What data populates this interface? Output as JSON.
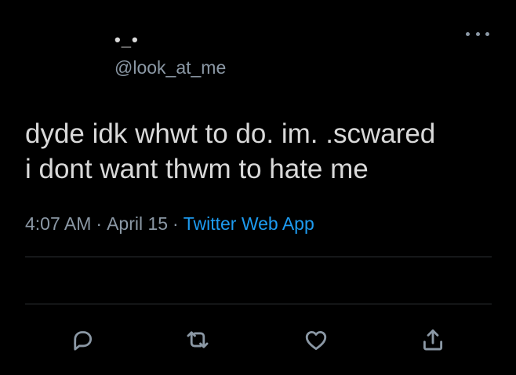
{
  "tweet": {
    "display_name": "•_•",
    "handle": "@look_at_me",
    "text": "dyde idk whwt to do. im. .scwared\ni dont want thwm to hate me",
    "time": "4:07 AM",
    "separator": "·",
    "date": "April 15",
    "source": "Twitter Web App"
  },
  "icons": {
    "more": "more-horizontal-icon",
    "reply": "reply-icon",
    "retweet": "retweet-icon",
    "like": "heart-icon",
    "share": "share-icon"
  },
  "colors": {
    "background": "#000000",
    "text": "#d9d9d9",
    "muted": "#8b98a5",
    "link": "#1d9bf0",
    "divider": "#2f3336"
  }
}
